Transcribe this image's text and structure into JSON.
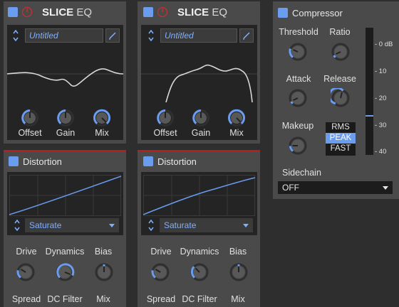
{
  "colors": {
    "accent": "#6a9cf0",
    "power_red": "#c43030",
    "separator_red": "#b32020",
    "panel": "#4a4a4a",
    "background": "#2e2e2e"
  },
  "eq": [
    {
      "brand_bold": "SLICE",
      "brand_light": "EQ",
      "preset": "Untitled",
      "knobs": [
        {
          "label": "Offset",
          "value": 0.5
        },
        {
          "label": "Gain",
          "value": 0.5
        },
        {
          "label": "Mix",
          "value": 1.0
        }
      ]
    },
    {
      "brand_bold": "SLICE",
      "brand_light": "EQ",
      "preset": "Untitled",
      "knobs": [
        {
          "label": "Offset",
          "value": 0.5
        },
        {
          "label": "Gain",
          "value": 0.5
        },
        {
          "label": "Mix",
          "value": 1.0
        }
      ]
    }
  ],
  "distortion": [
    {
      "title": "Distortion",
      "mode": "Saturate",
      "knob_labels": [
        "Drive",
        "Dynamics",
        "Bias"
      ],
      "knob_values": [
        0.4,
        0.85,
        0.5
      ],
      "bottom_labels": [
        "Spread",
        "DC Filter",
        "Mix"
      ]
    },
    {
      "title": "Distortion",
      "mode": "Saturate",
      "knob_labels": [
        "Drive",
        "Dynamics",
        "Bias"
      ],
      "knob_values": [
        0.4,
        0.45,
        0.5
      ],
      "bottom_labels": [
        "Spread",
        "DC Filter",
        "Mix"
      ]
    }
  ],
  "compressor": {
    "title": "Compressor",
    "threshold_label": "Threshold",
    "ratio_label": "Ratio",
    "attack_label": "Attack",
    "release_label": "Release",
    "makeup_label": "Makeup",
    "threshold_value": 0.35,
    "ratio_value": 0.15,
    "attack_value": 0.15,
    "release_value": 0.55,
    "makeup_value": 0.25,
    "modes": [
      "RMS",
      "PEAK",
      "FAST"
    ],
    "selected_mode": "PEAK",
    "meter_ticks": [
      "- 0 dB",
      "- 10",
      "- 20",
      "- 30",
      "- 40"
    ],
    "sidechain_label": "Sidechain",
    "sidechain_value": "OFF"
  }
}
